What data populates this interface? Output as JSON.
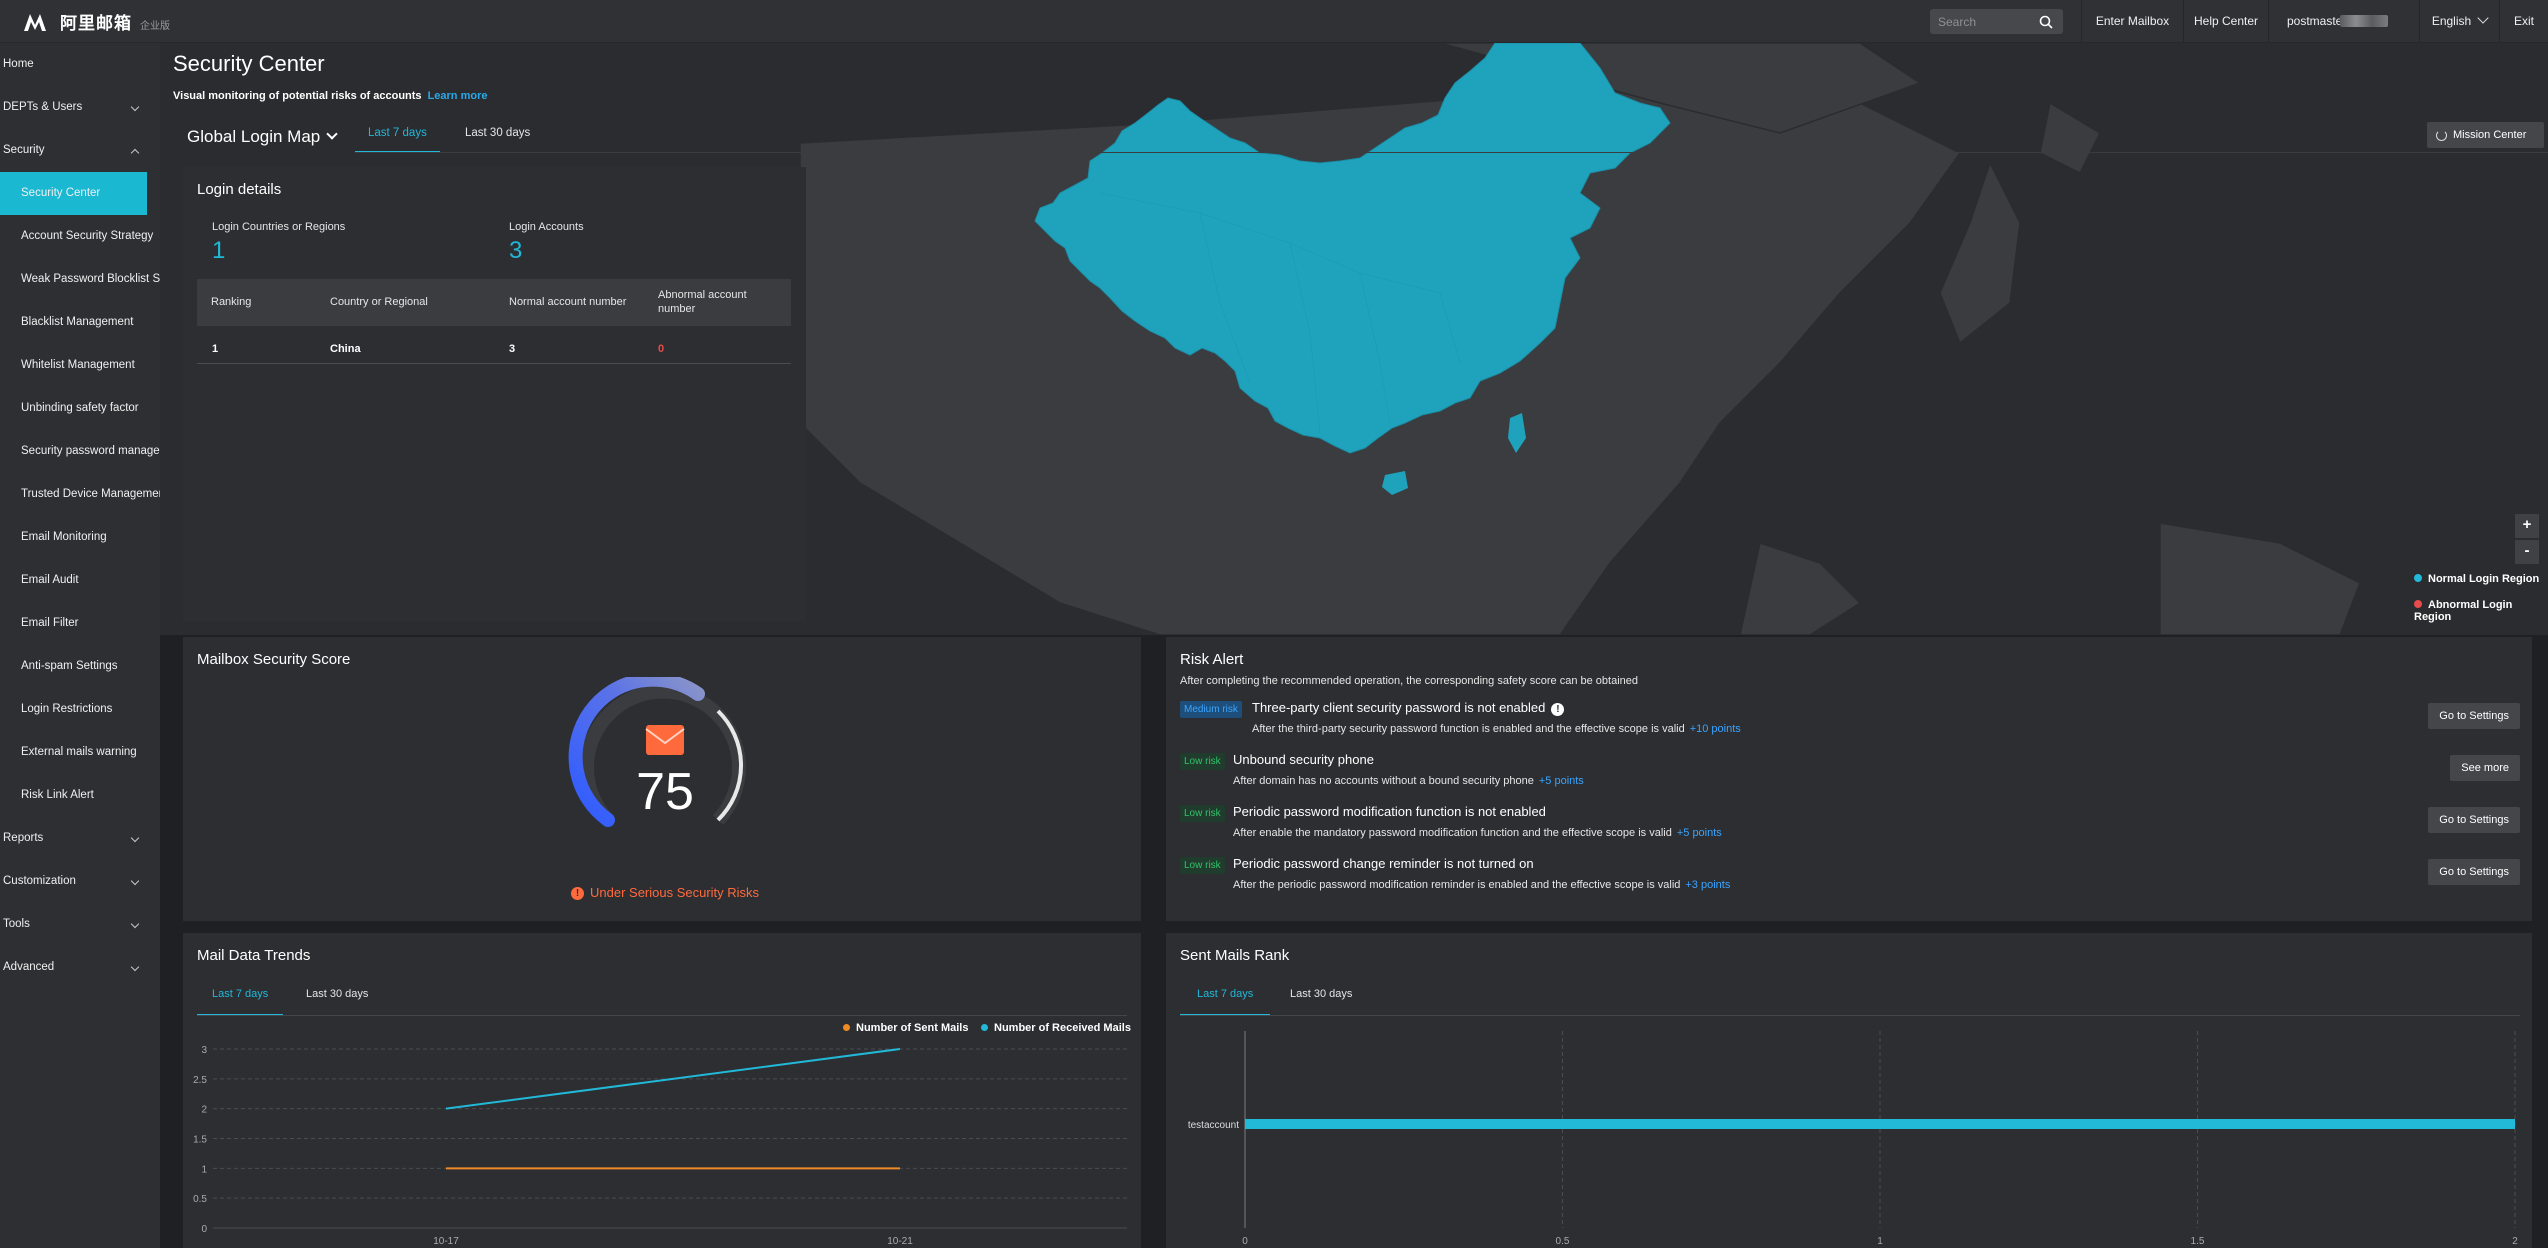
{
  "topbar": {
    "logo_text": "阿里邮箱",
    "edition": "企业版",
    "search_placeholder": "Search",
    "enter_mailbox": "Enter Mailbox",
    "help_center": "Help Center",
    "user": "postmaster@",
    "language": "English",
    "exit": "Exit"
  },
  "sidebar": {
    "items": [
      {
        "label": "Home"
      },
      {
        "label": "DEPTs & Users"
      },
      {
        "label": "Security"
      },
      {
        "label": "Security Center"
      },
      {
        "label": "Account Security Strategy"
      },
      {
        "label": "Weak Password Blocklist Set"
      },
      {
        "label": "Blacklist Management"
      },
      {
        "label": "Whitelist Management"
      },
      {
        "label": "Unbinding safety factor"
      },
      {
        "label": "Security password managem"
      },
      {
        "label": "Trusted Device Management"
      },
      {
        "label": "Email Monitoring"
      },
      {
        "label": "Email Audit"
      },
      {
        "label": "Email Filter"
      },
      {
        "label": "Anti-spam Settings"
      },
      {
        "label": "Login Restrictions"
      },
      {
        "label": "External mails warning"
      },
      {
        "label": "Risk Link Alert"
      },
      {
        "label": "Reports"
      },
      {
        "label": "Customization"
      },
      {
        "label": "Tools"
      },
      {
        "label": "Advanced"
      }
    ]
  },
  "header": {
    "title": "Security Center",
    "subtitle": "Visual monitoring of potential risks of accounts",
    "learn_more": "Learn more"
  },
  "map": {
    "title": "Global Login Map",
    "tabs": [
      "Last 7 days",
      "Last 30 days"
    ],
    "mission_center": "Mission Center",
    "zoom_in": "+",
    "zoom_out": "-",
    "legend": [
      {
        "label": "Normal Login Region",
        "color": "#22b8d8"
      },
      {
        "label": "Abnormal Login Region",
        "color": "#e84b4b"
      }
    ],
    "highlight_color": "#1fa3bd"
  },
  "login_details": {
    "title": "Login details",
    "countries_label": "Login Countries or Regions",
    "countries_value": "1",
    "accounts_label": "Login Accounts",
    "accounts_value": "3",
    "columns": [
      "Ranking",
      "Country or Regional",
      "Normal account number",
      "Abnormal account number"
    ],
    "rows": [
      {
        "ranking": "1",
        "country": "China",
        "normal": "3",
        "abnormal": "0"
      }
    ]
  },
  "score": {
    "title": "Mailbox Security Score",
    "value": "75",
    "status": "Under Serious Security Risks"
  },
  "risk_alert": {
    "title": "Risk Alert",
    "description": "After completing the recommended operation, the corresponding safety score can be obtained",
    "items": [
      {
        "level": "Medium risk",
        "title": "Three-party client security password is not enabled",
        "desc": "After the third-party security password function is enabled and the effective scope is valid",
        "points": "+10 points",
        "action": "Go to Settings"
      },
      {
        "level": "Low risk",
        "title": "Unbound security phone",
        "desc": "After domain has no accounts without a bound security phone",
        "points": "+5 points",
        "action": "See more"
      },
      {
        "level": "Low risk",
        "title": "Periodic password modification function is not enabled",
        "desc": "After enable the mandatory password modification function and the effective scope is valid",
        "points": "+5 points",
        "action": "Go to Settings"
      },
      {
        "level": "Low risk",
        "title": "Periodic password change reminder is not turned on",
        "desc": "After the periodic password modification reminder is enabled and the effective scope is valid",
        "points": "+3 points",
        "action": "Go to Settings"
      }
    ]
  },
  "trends": {
    "title": "Mail Data Trends",
    "tabs": [
      "Last 7 days",
      "Last 30 days"
    ]
  },
  "rank": {
    "title": "Sent Mails Rank",
    "tabs": [
      "Last 7 days",
      "Last 30 days"
    ]
  },
  "chart_data": [
    {
      "type": "line",
      "x": [
        "10-17",
        "10-21"
      ],
      "series": [
        {
          "name": "Number of Sent Mails",
          "color": "#f08a24",
          "values": [
            1,
            1
          ]
        },
        {
          "name": "Number of Received Mails",
          "color": "#22b8d8",
          "values": [
            2,
            3
          ]
        }
      ],
      "yticks": [
        "0",
        "0.5",
        "1",
        "1.5",
        "2",
        "2.5",
        "3"
      ],
      "ylim": [
        0,
        3
      ],
      "legend": "top-right",
      "grid": true
    },
    {
      "type": "bar",
      "orientation": "horizontal",
      "categories": [
        "testaccount"
      ],
      "values": [
        2
      ],
      "color": "#22b8d8",
      "xticks": [
        "0",
        "0.5",
        "1",
        "1.5",
        "2"
      ],
      "xlim": [
        0,
        2
      ],
      "grid": true
    }
  ]
}
